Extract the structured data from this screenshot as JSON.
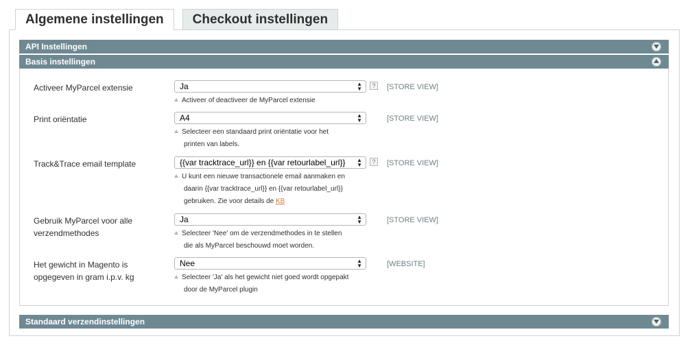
{
  "tabs": [
    {
      "label": "Algemene instellingen",
      "active": true
    },
    {
      "label": "Checkout instellingen",
      "active": false
    }
  ],
  "sections": {
    "api": {
      "title": "API Instellingen"
    },
    "basis": {
      "title": "Basis instellingen"
    },
    "standaard": {
      "title": "Standaard verzendinstellingen"
    }
  },
  "fields": [
    {
      "label": "Activeer MyParcel extensie",
      "value": "Ja",
      "note_lines": [
        "Activeer of deactiveer de MyParcel extensie"
      ],
      "scope": "[STORE VIEW]",
      "help": "?"
    },
    {
      "label": "Print oriëntatie",
      "value": "A4",
      "note_lines": [
        "Selecteer een standaard print oriëntatie voor het",
        "printen van labels."
      ],
      "scope": "[STORE VIEW]"
    },
    {
      "label": "Track&Trace email template",
      "value": "{{var tracktrace_url}} en {{var retourlabel_url}}",
      "note_lines": [
        "U kunt een nieuwe transactionele email aanmaken en",
        "daarin {{var tracktrace_url}} en {{var retourlabel_url}}",
        "gebruiken. Zie voor details de"
      ],
      "note_link": "KB",
      "scope": "[STORE VIEW]",
      "help": "?"
    },
    {
      "label_lines": [
        "Gebruik MyParcel voor alle",
        "verzendmethodes"
      ],
      "value": "Ja",
      "note_lines": [
        "Selecteer 'Nee' om de verzendmethodes in te stellen",
        "die als MyParcel beschouwd moet worden."
      ],
      "scope": "[STORE VIEW]"
    },
    {
      "label_lines": [
        "Het gewicht in Magento is",
        "opgegeven in gram i.p.v. kg"
      ],
      "value": "Nee",
      "note_lines": [
        "Selecteer 'Ja' als het gewicht niet goed wordt opgepakt",
        "door de MyParcel plugin"
      ],
      "scope": "[WEBSITE]"
    }
  ],
  "icons": {
    "select_arrows": "updown-arrows-icon",
    "toggle": "circle-chevron-icon",
    "note": "triangle-up-icon"
  }
}
